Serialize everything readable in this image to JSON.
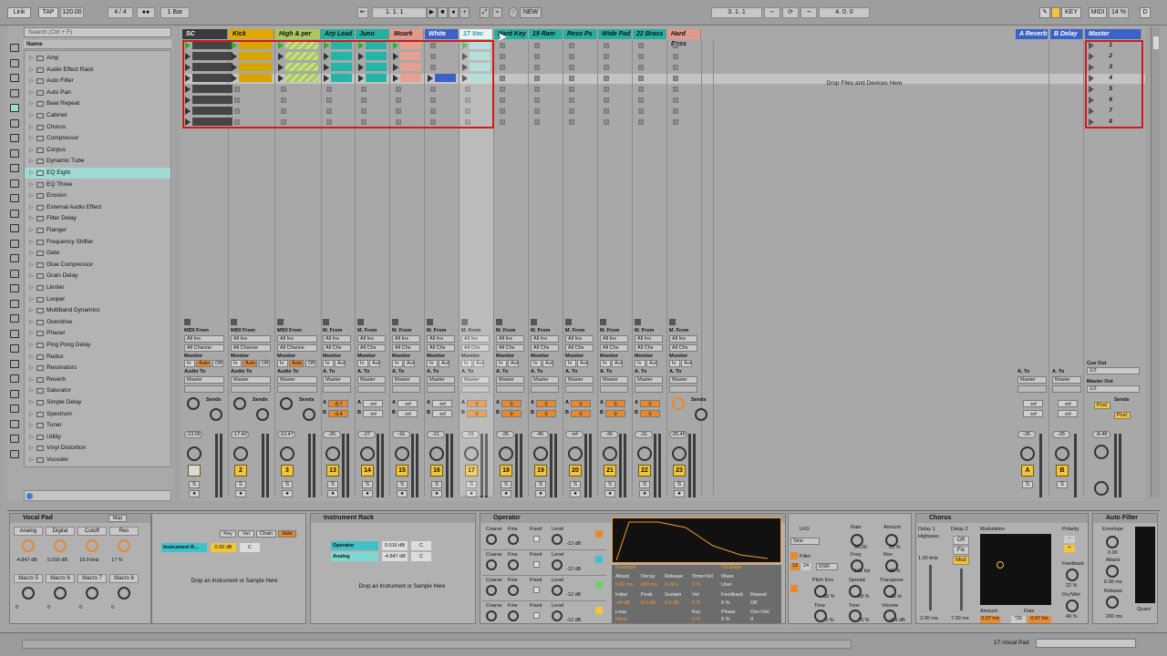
{
  "transport": {
    "link": "Link",
    "tap": "TAP",
    "bpm": "120.00",
    "signature": "4 / 4",
    "metro": "●●",
    "quant": "1 Bar",
    "pos": "1.   1.   1",
    "new": "NEW",
    "loop_start": "3.   1.   1",
    "loop_len": "4.   0.   0",
    "key": "KEY",
    "midi": "MIDI",
    "cpu": "14 %",
    "d": "D"
  },
  "browser": {
    "search_placeholder": "Search (Ctrl + F)",
    "header": "Name",
    "items": [
      "Amp",
      "Audio Effect Rack",
      "Auto Filter",
      "Auto Pan",
      "Beat Repeat",
      "Cabinet",
      "Chorus",
      "Compressor",
      "Corpus",
      "Dynamic Tube",
      "EQ Eight",
      "EQ Three",
      "Erosion",
      "External Audio Effect",
      "Filter Delay",
      "Flanger",
      "Frequency Shifter",
      "Gate",
      "Glue Compressor",
      "Grain Delay",
      "Limiter",
      "Looper",
      "Multiband Dynamics",
      "Overdrive",
      "Phaser",
      "Ping Pong Delay",
      "Redux",
      "Resonators",
      "Reverb",
      "Saturator",
      "Simple Delay",
      "Spectrum",
      "Tuner",
      "Utility",
      "Vinyl Distortion",
      "Vocoder"
    ],
    "selected": "EQ Eight"
  },
  "tracks": [
    {
      "name": "SC",
      "color": "#3a3a3a",
      "fg": "#ffffff",
      "num": "",
      "vol": "-13.06",
      "clipc": "#454545"
    },
    {
      "name": "Kick",
      "color": "#e0a800",
      "fg": "#111111",
      "num": "2",
      "vol": "-17.42",
      "clipc": "#d7a400"
    },
    {
      "name": "High & per",
      "color": "#a8c85c",
      "fg": "#111111",
      "num": "3",
      "vol": "-12.47",
      "clipc": "#a9c764"
    },
    {
      "name": "Arp Lead",
      "color": "#24b0a0",
      "fg": "#111111",
      "num": "13",
      "vol": "-25",
      "clipc": "#25b5a6"
    },
    {
      "name": "Juno",
      "color": "#24b0a0",
      "fg": "#111111",
      "num": "14",
      "vol": "-27",
      "clipc": "#25b5a6"
    },
    {
      "name": "Moark",
      "color": "#e3998a",
      "fg": "#111111",
      "num": "15",
      "vol": "-16",
      "clipc": "#e6a08f"
    },
    {
      "name": "White",
      "color": "#3b62c8",
      "fg": "#ffffff",
      "num": "16",
      "vol": "-21",
      "clipc": "#3b62c8"
    },
    {
      "name": "17 Voc",
      "color": "#2a9aa8",
      "fg": "#ffffff",
      "num": "17",
      "vol": "-31",
      "clipc": "#a0d6cf"
    },
    {
      "name": "Hard Key",
      "color": "#24b0a0",
      "fg": "#111111",
      "num": "18",
      "vol": "-25",
      "clipc": ""
    },
    {
      "name": "19 Ram",
      "color": "#24b0a0",
      "fg": "#111111",
      "num": "19",
      "vol": "-45",
      "clipc": ""
    },
    {
      "name": "Reso Ps",
      "color": "#24b0a0",
      "fg": "#111111",
      "num": "20",
      "vol": "-inf",
      "clipc": ""
    },
    {
      "name": "Wide Pad",
      "color": "#24b0a0",
      "fg": "#111111",
      "num": "21",
      "vol": "-30",
      "clipc": ""
    },
    {
      "name": "22 Brass",
      "color": "#24b0a0",
      "fg": "#111111",
      "num": "22",
      "vol": "-31",
      "clipc": ""
    },
    {
      "name": "Hard Bass",
      "color": "#e3998a",
      "fg": "#111111",
      "num": "23",
      "vol": "-25.40",
      "clipc": ""
    }
  ],
  "returns": [
    {
      "name": "A Reverb",
      "num": "A",
      "vol": "-26"
    },
    {
      "name": "B Delay",
      "num": "B",
      "vol": "-25"
    }
  ],
  "master": {
    "name": "Master",
    "scenes": [
      "1",
      "2",
      "3",
      "4",
      "5",
      "6",
      "7",
      "8"
    ],
    "vol": "-8.48",
    "cue_label": "Cue Out",
    "cue_value": "1/2",
    "master_out_label": "Master Out",
    "master_out_value": "1/2",
    "post": "Post"
  },
  "drop_text": "Drop Files and Devices Here",
  "mixer_labels": {
    "midi_from": "MIDI From",
    "all_ins": "All Ins",
    "all_channels": "All Channe",
    "monitor": "Monitor",
    "in": "In",
    "auto": "Auto",
    "off": "Off",
    "audio_to": "Audio To",
    "master": "Master",
    "sends": "Sends",
    "m_from": "M. From",
    "a_to": "A. To",
    "all_chs": "All Chs"
  },
  "sends": {
    "a": "-8.7",
    "b": "-9.4",
    "inf": "-inf",
    "zero": "0"
  },
  "devices": {
    "vocal_pad": {
      "title": "Vocal Pad",
      "map": "Map",
      "macros": [
        "Analog",
        "Digital",
        "Cutoff",
        "Res",
        "Macro 5",
        "Macro 6",
        "Macro 7",
        "Macro 8"
      ],
      "values": [
        "-4.847 dB",
        "0.016 dB",
        "19.9 kHz",
        "17 %",
        "0",
        "0",
        "0",
        "0"
      ],
      "chain": "Instrument R...",
      "chain_vol": "0.00 dB",
      "chain_pan": "C",
      "drop": "Drop an Instrument or Sample Here",
      "key": "Key",
      "vel": "Vel",
      "chainbtn": "Chain",
      "hide": "Hide"
    },
    "instrument_rack": {
      "title": "Instrument Rack",
      "chains": [
        {
          "name": "Operator",
          "vol": "0.016 dB",
          "pan": "C"
        },
        {
          "name": "Analog",
          "vol": "-4.847 dB",
          "pan": "C"
        }
      ],
      "drop": "Drop an Instrument or Sample Here"
    },
    "operator": {
      "title": "Operator",
      "rows": [
        {
          "coarse": "Coarse",
          "fine": "Fine",
          "fixed": "Fixed",
          "level": "Level",
          "lvl_val": "-12 dB"
        },
        {
          "coarse": "Coarse",
          "fine": "Fine",
          "fixed": "Fixed",
          "level": "Level",
          "lvl_val": "-12 dB"
        },
        {
          "coarse": "Coarse",
          "fine": "Fine",
          "fixed": "Fixed",
          "level": "Level",
          "lvl_val": "-12 dB"
        },
        {
          "coarse": "Coarse",
          "fine": "Fine",
          "fixed": "Fixed",
          "level": "Level",
          "lvl_val": "-12 dB"
        }
      ],
      "envelope": "Envelope",
      "oscillator": "Oscillator",
      "attack": "Attack",
      "decay": "Decay",
      "release": "Release",
      "time_vel": "Time<Vel",
      "wave": "Wave",
      "attack_v": "0.92 ms",
      "decay_v": "600 ms",
      "release_v": "8.20 s",
      "tv_v": "0 %",
      "wave_v": "User",
      "initial": "Initial",
      "peak": "Peak",
      "sustain": "Sustain",
      "vel": "Vel",
      "feedback": "Feedback",
      "repeat": "Repeat",
      "initial_v": "-inf dB",
      "peak_v": "0.0 dB",
      "sustain_v": "0.0 dB",
      "vel_v": "0 %",
      "fb_v": "0 %",
      "repeat_v": "Off",
      "loop": "Loop",
      "key": "Key",
      "phase": "Phase",
      "osc_vel": "Osc<Vel",
      "loop_v": "None",
      "key_v": "0 %",
      "phase_v": "0 %",
      "ov_v": "0"
    },
    "lfo": {
      "lfo": "LFO",
      "rate": "Rate",
      "amount": "Amount",
      "sine": "Sine",
      "rate_v": "64.00",
      "amt_v": "25 %",
      "filter": "Filter",
      "freq": "Freq",
      "res": "Res",
      "freq_v": "102 Hz",
      "res_v": "45 %",
      "f12": "12",
      "f24": "24",
      "osr": "OSR",
      "pitch_env": "Pitch Env",
      "spread": "Spread",
      "transpose": "Transpose",
      "pe_v": "38 %",
      "sp_v": "58 %",
      "tr_v": "-12 st",
      "time": "Time",
      "tone": "Tone",
      "volume": "Volume",
      "time_v": "0 %",
      "tone_v": "70 %",
      "vol_v": "-9.9 dB"
    },
    "chorus": {
      "title": "Chorus",
      "delay1": "Delay 1",
      "highpass": "Highpass",
      "delay2": "Delay 2",
      "modulation": "Modulation",
      "polarity": "Polarity",
      "hp_v": "1.00 kHz",
      "d1_v": "3.00 ms",
      "d2_v": "7.00 ms",
      "off": "Off",
      "fix": "Fix",
      "mod": "Mod",
      "amount": "Amount",
      "rate": "Rate",
      "amt_v": "2.37 ms",
      "rate_v": "0.97 Hz",
      "x20": "*20",
      "feedback": "Feedback",
      "fb_v": "22 %",
      "drywet": "Dry/Wet",
      "dw_v": "49 %"
    },
    "autofilter": {
      "title": "Auto Filter",
      "envelope": "Envelope",
      "env_v": "0.00",
      "attack": "Attack",
      "att_v": "6.00 ms",
      "release": "Release",
      "rel_v": "200 ms",
      "quant": "Quant"
    }
  },
  "status": {
    "track": "17-Vocal Pad"
  }
}
